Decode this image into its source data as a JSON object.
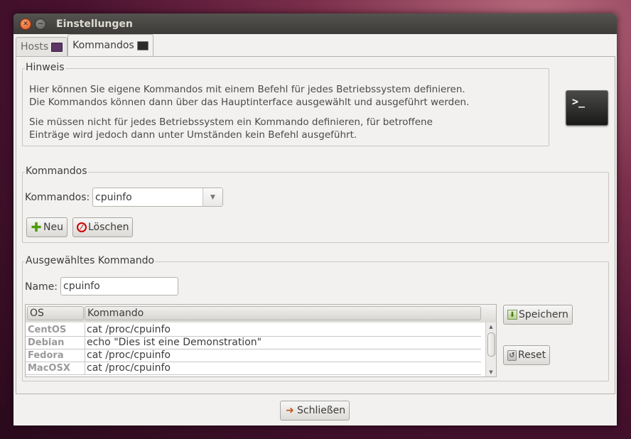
{
  "window": {
    "title": "Einstellungen"
  },
  "tabs": [
    {
      "label": "Hosts",
      "icon": "monitor-icon",
      "active": false
    },
    {
      "label": "Kommandos",
      "icon": "terminal-icon",
      "active": true
    }
  ],
  "hint": {
    "legend": "Hinweis",
    "line1": "Hier können Sie eigene Kommandos mit einem Befehl für jedes Betriebssystem definieren.",
    "line2": "Die Kommandos können dann über das Hauptinterface ausgewählt und ausgeführt werden.",
    "line3": "Sie müssen nicht für jedes Betriebssystem ein Kommando definieren, für betroffene",
    "line4": "Einträge wird jedoch dann unter Umständen kein Befehl ausgeführt.",
    "icon_text": ">_"
  },
  "commands": {
    "legend": "Kommandos",
    "label": "Kommandos:",
    "selected": "cpuinfo",
    "new_label": "Neu",
    "delete_label": "Löschen"
  },
  "selected_command": {
    "legend": "Ausgewähltes Kommando",
    "name_label": "Name:",
    "name_value": "cpuinfo",
    "columns": [
      "OS",
      "Kommando"
    ],
    "rows": [
      {
        "os": "CentOS",
        "cmd": "cat /proc/cpuinfo"
      },
      {
        "os": "Debian",
        "cmd": "echo \"Dies ist eine Demonstration\""
      },
      {
        "os": "Fedora",
        "cmd": "cat /proc/cpuinfo"
      },
      {
        "os": "MacOSX",
        "cmd": "cat /proc/cpuinfo"
      }
    ],
    "save_label": "Speichern",
    "reset_label": "Reset"
  },
  "footer": {
    "close_label": "Schließen"
  },
  "colors": {
    "accent_close": "#e2571e",
    "window_bg": "#f2f1f0",
    "titlebar": "#3c3b37"
  }
}
